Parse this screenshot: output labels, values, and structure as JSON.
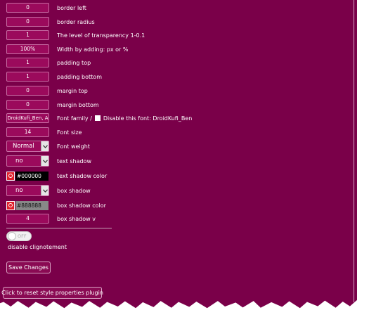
{
  "rows": [
    {
      "value": "0",
      "label": "border left"
    },
    {
      "value": "0",
      "label": "border radius"
    },
    {
      "value": "1",
      "label": "The level of transparency 1-0.1"
    },
    {
      "value": "100%",
      "label": "Width by adding: px or %"
    },
    {
      "value": "1",
      "label": "padding top"
    },
    {
      "value": "1",
      "label": "padding bottom"
    },
    {
      "value": "0",
      "label": "margin top"
    },
    {
      "value": "0",
      "label": "margin bottom"
    }
  ],
  "font_family": {
    "value": "DroidKufi_Ben, A",
    "label": "Font family /",
    "checkbox_label": "Disable this font: DroidKufi_Ben"
  },
  "font_size": {
    "value": "14",
    "label": "Font size"
  },
  "font_weight": {
    "value": "Normal",
    "label": "Font weight"
  },
  "text_shadow": {
    "value": "no",
    "label": "text shadow"
  },
  "text_shadow_color": {
    "value": "#000000",
    "label": "text shadow color",
    "bg": "#000000"
  },
  "box_shadow": {
    "value": "no",
    "label": "box shadow"
  },
  "box_shadow_color": {
    "value": "#888888",
    "label": "box shadow color",
    "bg": "#888888"
  },
  "box_shadow_v": {
    "value": "4",
    "label": "box shadow v"
  },
  "toggle": {
    "state": "OFF",
    "label": "disable clignotement"
  },
  "buttons": {
    "save": "Save Changes",
    "reset": "Click to reset style properties plugin"
  },
  "colors": {
    "panel_bg": "#7a0049",
    "field_bg": "#9b0a5c",
    "field_border": "#c86ba3",
    "swatch_red": "#e0202a"
  },
  "icons": {
    "select_arrow": "chevron-down-icon",
    "color_picker": "color-picker-icon"
  }
}
